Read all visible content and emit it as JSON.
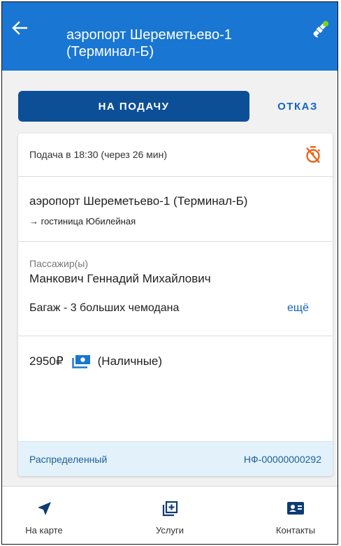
{
  "header": {
    "title_line1": "аэропорт Шереметьево-1",
    "title_line2": "(Терминал-Б)",
    "back_icon": "arrow-left-icon",
    "gps_icon": "satellite-icon"
  },
  "actions": {
    "primary_label": "НА ПОДАЧУ",
    "secondary_label": "ОТКАЗ"
  },
  "order": {
    "pickup_text": "Подача в 18:30 (через 26 мин)",
    "route_from": "аэропорт Шереметьево-1 (Терминал-Б)",
    "route_to": "→ гостиница Юбилейная",
    "passenger_label": "Пассажир(ы)",
    "passenger_name": "Манкович Геннадий Михайлович",
    "luggage": "Багаж - 3 больших чемодана",
    "more_link": "ещё",
    "price": "2950₽",
    "payment_method": "(Наличные)",
    "status": "Распределенный",
    "order_number": "НФ-00000000292"
  },
  "bottom_nav": {
    "map_label": "На карте",
    "services_label": "Услуги",
    "contacts_label": "Контакты"
  },
  "colors": {
    "appbar": "#1976d2",
    "primary_button": "#0d4f96",
    "accent_text": "#1565c0",
    "timer_icon": "#e8641b",
    "gps_dot": "#7ed321",
    "status_strip": "#e3f1fb"
  }
}
